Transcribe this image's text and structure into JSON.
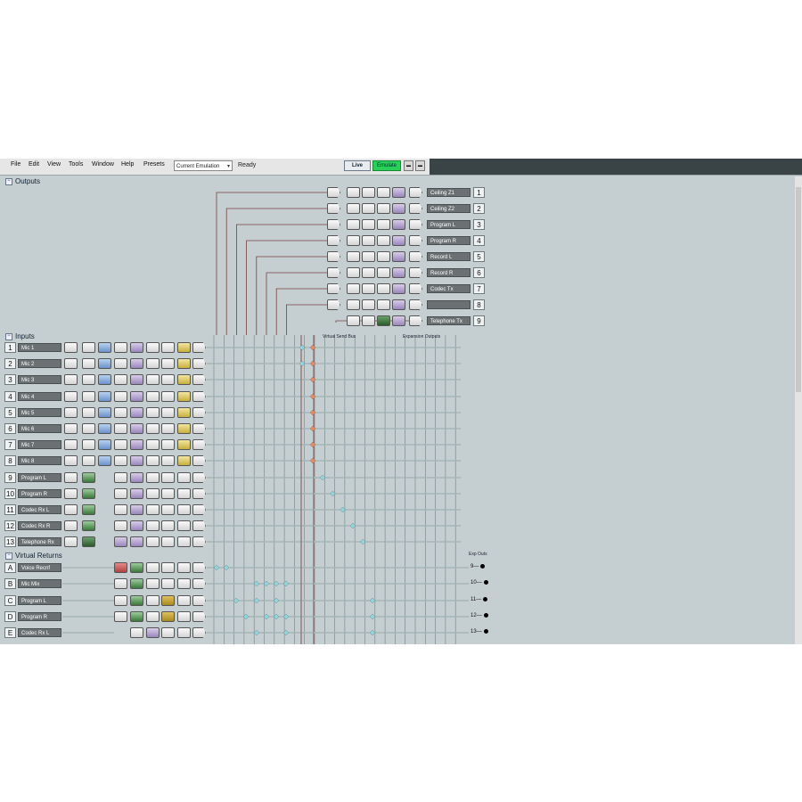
{
  "menu": {
    "items": [
      "File",
      "Edit",
      "View",
      "Tools",
      "Window",
      "Help",
      "Presets"
    ],
    "preset_value": "Current Emulation",
    "status": "Ready",
    "live_label": "Live",
    "emulate_label": "Emulate"
  },
  "sections": {
    "outputs": "Outputs",
    "inputs": "Inputs",
    "virtual_returns": "Virtual Returns"
  },
  "outputs": [
    {
      "num": "1",
      "name": "Ceiling Z1"
    },
    {
      "num": "2",
      "name": "Ceiling Z2"
    },
    {
      "num": "3",
      "name": "Program L"
    },
    {
      "num": "4",
      "name": "Program R"
    },
    {
      "num": "5",
      "name": "Record L"
    },
    {
      "num": "6",
      "name": "Record R"
    },
    {
      "num": "7",
      "name": "Codec Tx"
    },
    {
      "num": "8",
      "name": ""
    },
    {
      "num": "9",
      "name": "Telephone Tx"
    }
  ],
  "inputs": [
    {
      "num": "1",
      "name": "Mic 1"
    },
    {
      "num": "2",
      "name": "Mic 2"
    },
    {
      "num": "3",
      "name": "Mic 3"
    },
    {
      "num": "4",
      "name": "Mic 4"
    },
    {
      "num": "5",
      "name": "Mic 5"
    },
    {
      "num": "6",
      "name": "Mic 6"
    },
    {
      "num": "7",
      "name": "Mic 7"
    },
    {
      "num": "8",
      "name": "Mic 8"
    },
    {
      "num": "9",
      "name": "Program L"
    },
    {
      "num": "10",
      "name": "Program R"
    },
    {
      "num": "11",
      "name": "Codec Rx L"
    },
    {
      "num": "12",
      "name": "Codec Rx R"
    },
    {
      "num": "13",
      "name": "Telephone Rx"
    }
  ],
  "virtual_returns": [
    {
      "num": "A",
      "name": "Voice Recnf"
    },
    {
      "num": "B",
      "name": "Mic Mix"
    },
    {
      "num": "C",
      "name": "Program L"
    },
    {
      "num": "D",
      "name": "Program R"
    },
    {
      "num": "E",
      "name": "Codec Rx L"
    }
  ],
  "labels": {
    "virtual_send_bus": "Virtual Send Bus",
    "expansion_outputs": "Expansion Outputs",
    "exp_outs": "Exp Outs"
  },
  "exp_outs": [
    "9",
    "10",
    "11",
    "12",
    "13"
  ],
  "colors": {
    "background": "#c5cfd1",
    "grid_line": "#6f8284",
    "crosspoint_on": "#e88a5a",
    "crosspoint_cyan": "#8fd6d8",
    "wire": "#7a4040"
  }
}
